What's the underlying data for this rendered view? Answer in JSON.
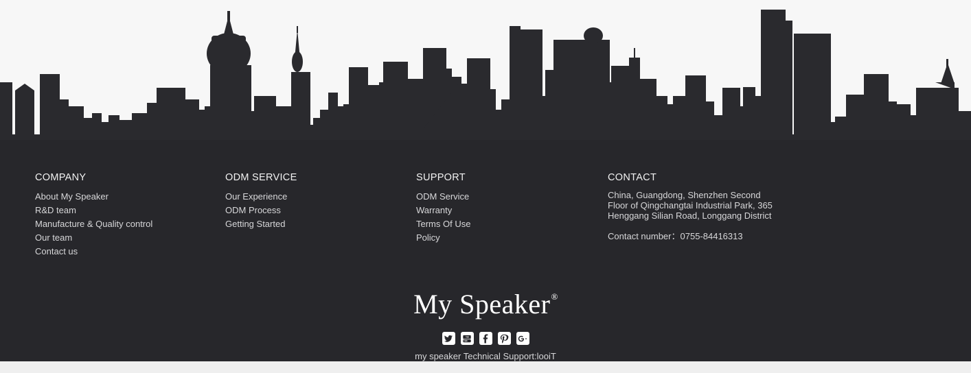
{
  "background": {
    "sky_color": "#f7f7f7",
    "footer_color": "#27272b",
    "skyline_color": "#2a2a2e",
    "strip_color": "#efefef",
    "heading_color": "#f2f2f2",
    "link_color": "#d7d7d9"
  },
  "columns": [
    {
      "title": "COMPANY",
      "links": [
        "About My Speaker",
        "R&D team",
        "Manufacture & Quality control",
        "Our team",
        "Contact us"
      ]
    },
    {
      "title": "ODM SERVICE",
      "links": [
        "Our Experience",
        "ODM Process",
        "Getting Started"
      ]
    },
    {
      "title": "SUPPORT",
      "links": [
        "ODM Service",
        "Warranty",
        "Terms Of Use",
        "Policy"
      ]
    }
  ],
  "contact": {
    "title": "CONTACT",
    "address_lines": [
      "China, Guangdong, Shenzhen Second",
      "Floor of Qingchangtai Industrial Park, 365",
      "Henggang Silian Road, Longgang District"
    ],
    "contact_number_label": "Contact number：",
    "contact_number_value": "0755-84416313"
  },
  "brand": {
    "name": "My Speaker",
    "registered_mark": "®"
  },
  "social": [
    {
      "name": "twitter",
      "label": "Twitter"
    },
    {
      "name": "youtube",
      "label": "YouTube"
    },
    {
      "name": "facebook",
      "label": "Facebook"
    },
    {
      "name": "pinterest",
      "label": "Pinterest"
    },
    {
      "name": "googleplus",
      "label": "Google Plus"
    }
  ],
  "support_line": "my speaker Technical Support:looiT"
}
